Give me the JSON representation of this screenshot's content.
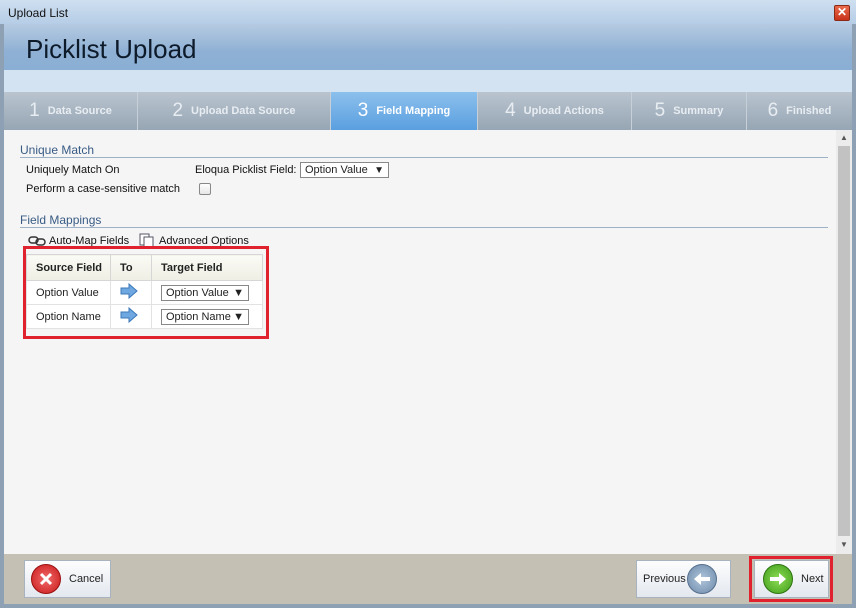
{
  "window": {
    "title": "Upload List",
    "close": "✕"
  },
  "header": {
    "title": "Picklist Upload"
  },
  "steps": [
    {
      "num": "1",
      "label": "Data Source"
    },
    {
      "num": "2",
      "label": "Upload Data Source"
    },
    {
      "num": "3",
      "label": "Field Mapping"
    },
    {
      "num": "4",
      "label": "Upload Actions"
    },
    {
      "num": "5",
      "label": "Summary"
    },
    {
      "num": "6",
      "label": "Finished"
    }
  ],
  "active_step": "Field Mapping",
  "unique_match": {
    "heading": "Unique Match",
    "uniquely_match_on": "Uniquely Match On",
    "picklist_field_label": "Eloqua Picklist Field:",
    "picklist_field_value": "Option Value",
    "case_sensitive_label": "Perform a case-sensitive match",
    "case_sensitive_checked": false
  },
  "field_mappings": {
    "heading": "Field Mappings",
    "auto_map": "Auto-Map Fields",
    "advanced": "Advanced Options",
    "columns": [
      "Source Field",
      "To",
      "Target Field"
    ],
    "rows": [
      {
        "source": "Option Value",
        "target": "Option Value"
      },
      {
        "source": "Option Name",
        "target": "Option Name"
      }
    ]
  },
  "footer": {
    "cancel": "Cancel",
    "previous": "Previous",
    "next": "Next"
  },
  "colors": {
    "active_step": "#5a9fe0",
    "highlight": "#e0222e",
    "heading": "#385b85"
  }
}
